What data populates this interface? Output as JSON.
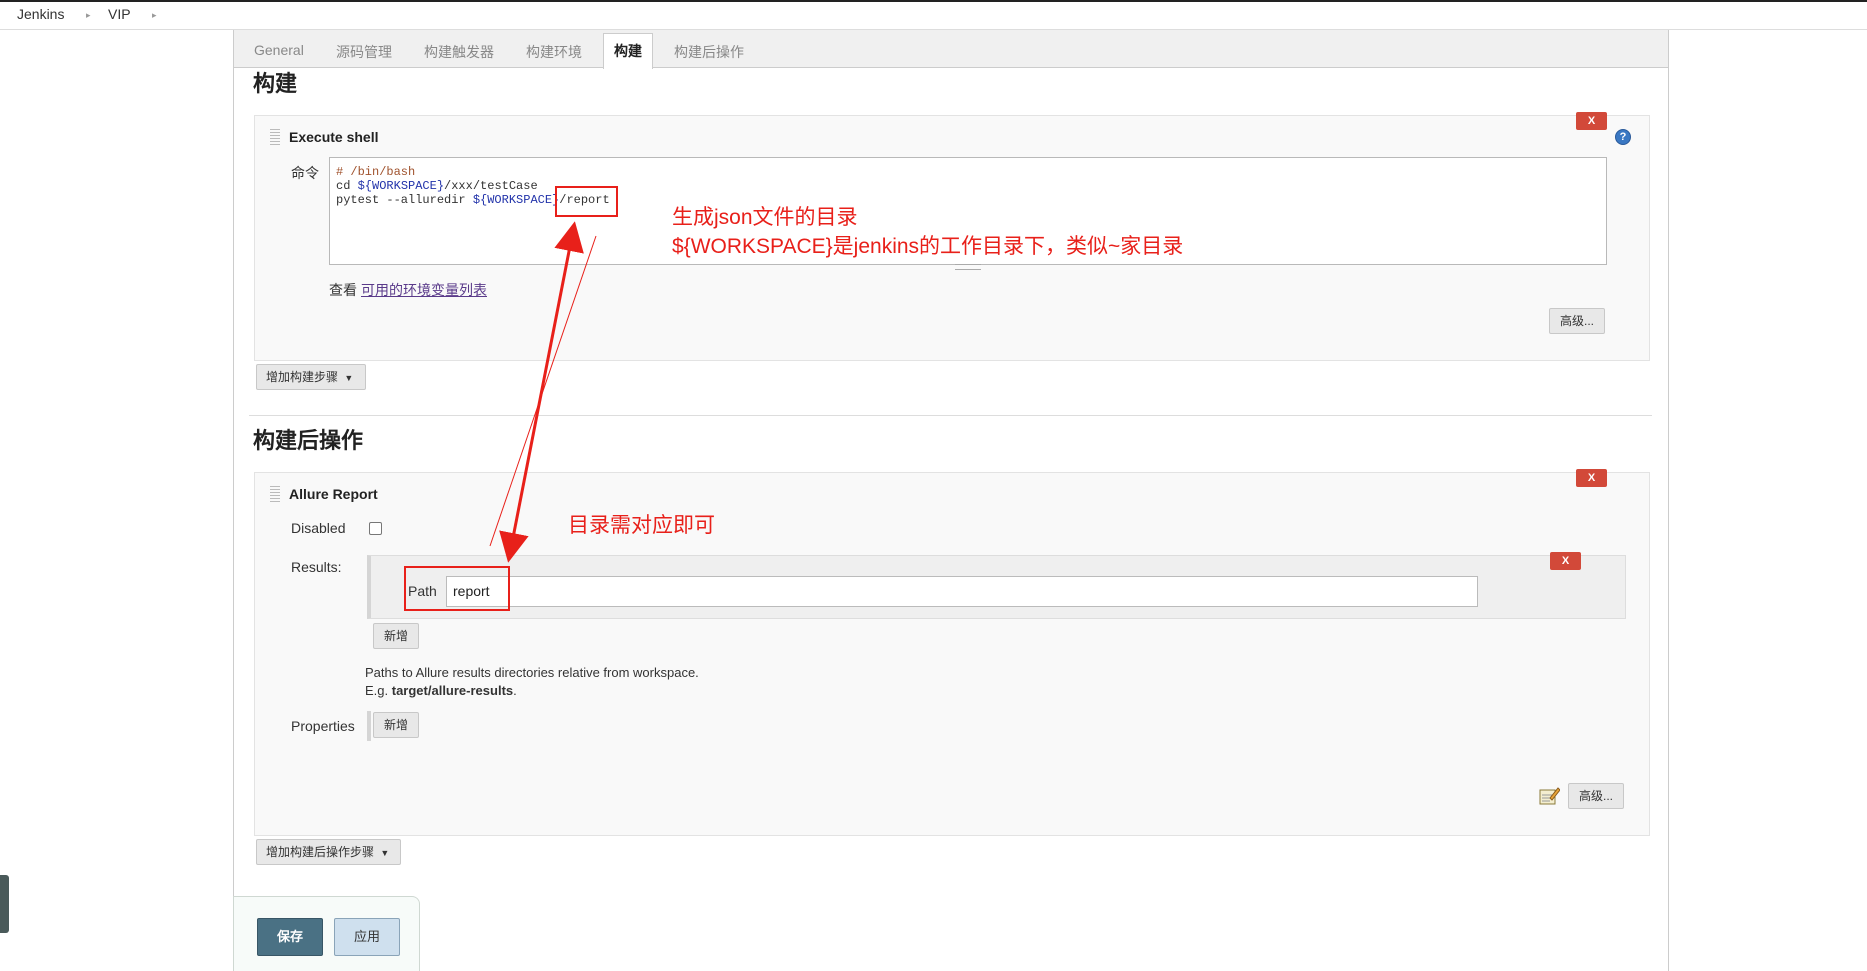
{
  "breadcrumb": {
    "items": [
      "Jenkins",
      "VIP"
    ],
    "separator": "▸"
  },
  "tabs": [
    {
      "label": "General"
    },
    {
      "label": "源码管理"
    },
    {
      "label": "构建触发器"
    },
    {
      "label": "构建环境"
    },
    {
      "label": "构建"
    },
    {
      "label": "构建后操作"
    }
  ],
  "build": {
    "section_title": "构建",
    "step": {
      "title": "Execute shell",
      "delete_label": "X",
      "help_icon": "question-icon",
      "command_label": "命令",
      "command_lines": [
        "# /bin/bash",
        "cd ${WORKSPACE}/xxx/testCase",
        "pytest --alluredir ${WORKSPACE}/report"
      ],
      "env_prefix": "查看",
      "env_link": "可用的环境变量列表",
      "advanced_label": "高级..."
    },
    "add_step_label": "增加构建步骤"
  },
  "post_build": {
    "section_title": "构建后操作",
    "allure": {
      "title": "Allure Report",
      "delete_label": "X",
      "disabled_label": "Disabled",
      "disabled_checked": false,
      "results_label": "Results:",
      "path_label": "Path",
      "path_value": "report",
      "path_delete_label": "X",
      "add_label": "新增",
      "help_line1": "Paths to Allure results directories relative from workspace.",
      "help_line2_prefix": "E.g. ",
      "help_line2_bold": "target/allure-results",
      "help_line2_suffix": ".",
      "properties_label": "Properties",
      "properties_add_label": "新增",
      "advanced_label": "高级..."
    },
    "add_step_label": "增加构建后操作步骤"
  },
  "footer": {
    "save_label": "保存",
    "apply_label": "应用"
  },
  "annotations": {
    "note1_line1": "生成json文件的目录",
    "note1_line2": "${WORKSPACE}是jenkins的工作目录下，类似~家目录",
    "note2": "目录需对应即可",
    "color": "#e8201a"
  }
}
